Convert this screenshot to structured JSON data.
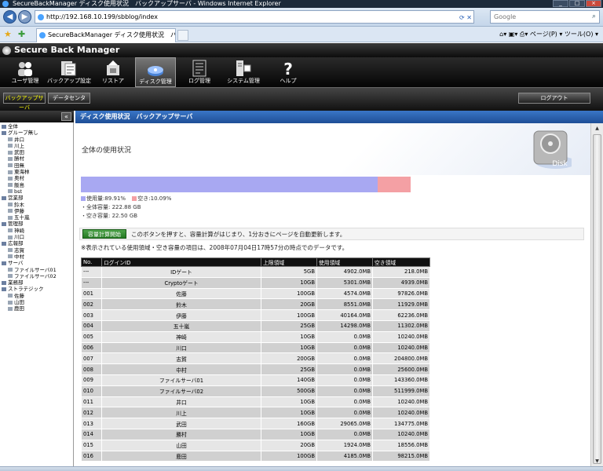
{
  "browser": {
    "window_title": "SecureBackManager ディスク使用状況　バックアップサーバ - Windows Internet Explorer",
    "address": "http://192.168.10.199/sbblog/index",
    "search_placeholder": "Google",
    "tab_title": "SecureBackManager ディスク使用状況　バッ...",
    "command_bar": "ページ(P) ▾  ツール(O) ▾"
  },
  "app": {
    "title": "Secure Back Manager",
    "toolbar": [
      {
        "label": "ユーザ管理",
        "icon": "users-icon"
      },
      {
        "label": "バックアップ設定",
        "icon": "backup-settings-icon"
      },
      {
        "label": "リストア",
        "icon": "restore-icon"
      },
      {
        "label": "ディスク管理",
        "icon": "disk-management-icon",
        "active": true
      },
      {
        "label": "ログ管理",
        "icon": "log-icon"
      },
      {
        "label": "システム管理",
        "icon": "system-icon"
      },
      {
        "label": "ヘルプ",
        "icon": "help-icon"
      }
    ],
    "subtabs": [
      "バックアップサーバ",
      "データセンタ"
    ],
    "logout": "ログアウト"
  },
  "tree": [
    {
      "label": "全体",
      "level": 0
    },
    {
      "label": "グループ無し",
      "level": 0
    },
    {
      "label": "井口",
      "level": 1
    },
    {
      "label": "川上",
      "level": 1
    },
    {
      "label": "武田",
      "level": 1
    },
    {
      "label": "勝村",
      "level": 1
    },
    {
      "label": "田無",
      "level": 1
    },
    {
      "label": "東海林",
      "level": 1
    },
    {
      "label": "奥村",
      "level": 1
    },
    {
      "label": "飯島",
      "level": 1
    },
    {
      "label": "bst",
      "level": 1
    },
    {
      "label": "営業部",
      "level": 0
    },
    {
      "label": "鈴木",
      "level": 1
    },
    {
      "label": "伊藤",
      "level": 1
    },
    {
      "label": "五十嵐",
      "level": 1
    },
    {
      "label": "管理部",
      "level": 0
    },
    {
      "label": "神崎",
      "level": 1
    },
    {
      "label": "川口",
      "level": 1
    },
    {
      "label": "広報部",
      "level": 0
    },
    {
      "label": "志賀",
      "level": 1
    },
    {
      "label": "中村",
      "level": 1
    },
    {
      "label": "サーバ",
      "level": 0
    },
    {
      "label": "ファイルサーバ01",
      "level": 1
    },
    {
      "label": "ファイルサーバ02",
      "level": 1
    },
    {
      "label": "業務部",
      "level": 0
    },
    {
      "label": "ストラテジック",
      "level": 0
    },
    {
      "label": "佐藤",
      "level": 1
    },
    {
      "label": "山田",
      "level": 1
    },
    {
      "label": "鹿田",
      "level": 1
    }
  ],
  "main": {
    "header_title": "ディスク使用状況　バックアップサーバ",
    "section_title": "全体の使用状況",
    "disk_label": "Disk",
    "usage": {
      "used_fraction": 0.8991,
      "used_legend": "使用量:89.91%",
      "free_legend": "空き:10.09%",
      "used_color": "#a8a8f2",
      "free_color": "#f4a0a4",
      "total_capacity": "・全体容量: 222.88 GB",
      "free_capacity": "・空き容量: 22.50 GB"
    },
    "calc_button": "容量計算開始",
    "calc_text": "このボタンを押すと、容量計算がはじまり、1分おきにページを自動更新します。",
    "note": "※表示されている使用領域・空き容量の項目は、2008年07月04日17時57分の時点でのデータです。",
    "table": {
      "headers": [
        "No.",
        "ログインID",
        "上限領域",
        "使用領域",
        "空き領域"
      ],
      "rows": [
        [
          "---",
          "IDゲート",
          "5GB",
          "4902.0MB",
          "218.0MB"
        ],
        [
          "---",
          "Cryptoゲート",
          "10GB",
          "5301.0MB",
          "4939.0MB"
        ],
        [
          "001",
          "佐藤",
          "100GB",
          "4574.0MB",
          "97826.0MB"
        ],
        [
          "002",
          "鈴木",
          "20GB",
          "8551.0MB",
          "11929.0MB"
        ],
        [
          "003",
          "伊藤",
          "100GB",
          "40164.0MB",
          "62236.0MB"
        ],
        [
          "004",
          "五十嵐",
          "25GB",
          "14298.0MB",
          "11302.0MB"
        ],
        [
          "005",
          "神崎",
          "10GB",
          "0.0MB",
          "10240.0MB"
        ],
        [
          "006",
          "川口",
          "10GB",
          "0.0MB",
          "10240.0MB"
        ],
        [
          "007",
          "志賀",
          "200GB",
          "0.0MB",
          "204800.0MB"
        ],
        [
          "008",
          "中村",
          "25GB",
          "0.0MB",
          "25600.0MB"
        ],
        [
          "009",
          "ファイルサーバ01",
          "140GB",
          "0.0MB",
          "143360.0MB"
        ],
        [
          "010",
          "ファイルサーバ02",
          "500GB",
          "0.0MB",
          "511999.0MB"
        ],
        [
          "011",
          "井口",
          "10GB",
          "0.0MB",
          "10240.0MB"
        ],
        [
          "012",
          "川上",
          "10GB",
          "0.0MB",
          "10240.0MB"
        ],
        [
          "013",
          "武田",
          "160GB",
          "29065.0MB",
          "134775.0MB"
        ],
        [
          "014",
          "勝村",
          "10GB",
          "0.0MB",
          "10240.0MB"
        ],
        [
          "015",
          "山田",
          "20GB",
          "1924.0MB",
          "18556.0MB"
        ],
        [
          "016",
          "鹿田",
          "100GB",
          "4185.0MB",
          "98215.0MB"
        ]
      ]
    }
  }
}
